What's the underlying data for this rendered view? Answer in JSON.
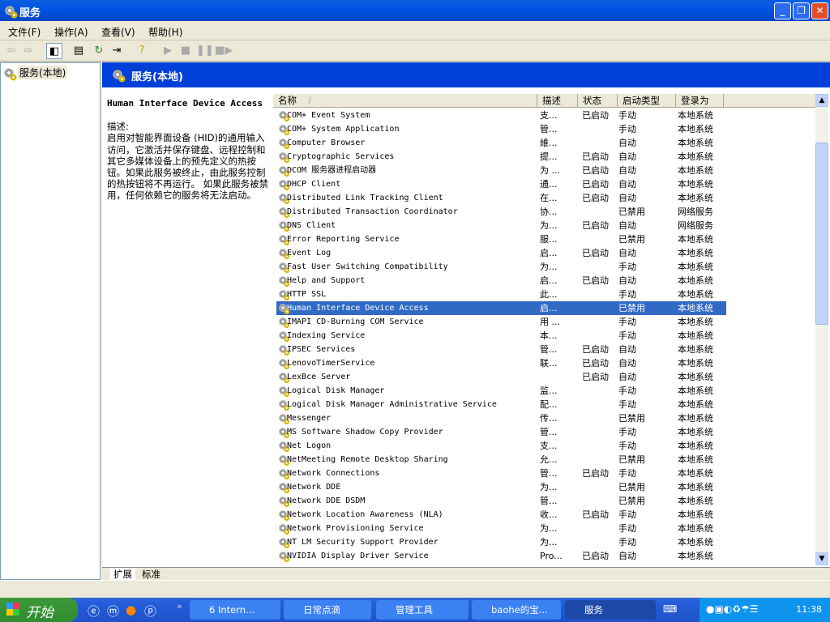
{
  "window": {
    "title": "服务",
    "minimize": "_",
    "restore": "❐",
    "close": "✕"
  },
  "menu": [
    "文件(F)",
    "操作(A)",
    "查看(V)",
    "帮助(H)"
  ],
  "tree": {
    "root": "服务(本地)"
  },
  "pane": {
    "header": "服务(本地)"
  },
  "description": {
    "service_name": "Human Interface Device Access",
    "label": "描述:",
    "text": "启用对智能界面设备 (HID)的通用输入访问，它激活并保存键盘、远程控制和其它多媒体设备上的预先定义的热按钮。如果此服务被终止，由此服务控制的热按钮将不再运行。 如果此服务被禁用，任何依赖它的服务将无法启动。"
  },
  "columns": [
    "名称",
    "描述",
    "状态",
    "启动类型",
    "登录为"
  ],
  "sort_indicator": "/",
  "rows": [
    [
      "COM+ Event System",
      "支...",
      "已启动",
      "手动",
      "本地系统"
    ],
    [
      "COM+ System Application",
      "管...",
      "",
      "手动",
      "本地系统"
    ],
    [
      "Computer Browser",
      "維...",
      "",
      "自动",
      "本地系统"
    ],
    [
      "Cryptographic Services",
      "提...",
      "已启动",
      "自动",
      "本地系统"
    ],
    [
      "DCOM 服务器进程启动器",
      "为 ...",
      "已启动",
      "自动",
      "本地系统"
    ],
    [
      "DHCP Client",
      "通...",
      "已启动",
      "自动",
      "本地系统"
    ],
    [
      "Distributed Link Tracking Client",
      "在...",
      "已启动",
      "自动",
      "本地系统"
    ],
    [
      "Distributed Transaction Coordinator",
      "协...",
      "",
      "已禁用",
      "网络服务"
    ],
    [
      "DNS Client",
      "为...",
      "已启动",
      "自动",
      "网络服务"
    ],
    [
      "Error Reporting Service",
      "服...",
      "",
      "已禁用",
      "本地系统"
    ],
    [
      "Event Log",
      "启...",
      "已启动",
      "自动",
      "本地系统"
    ],
    [
      "Fast User Switching Compatibility",
      "为...",
      "",
      "手动",
      "本地系统"
    ],
    [
      "Help and Support",
      "启...",
      "已启动",
      "自动",
      "本地系统"
    ],
    [
      "HTTP SSL",
      "此...",
      "",
      "手动",
      "本地系统"
    ],
    [
      "Human Interface Device Access",
      "启...",
      "",
      "已禁用",
      "本地系统"
    ],
    [
      "IMAPI CD-Burning COM Service",
      "用 ...",
      "",
      "手动",
      "本地系统"
    ],
    [
      "Indexing Service",
      "本...",
      "",
      "手动",
      "本地系统"
    ],
    [
      "IPSEC Services",
      "管...",
      "已启动",
      "自动",
      "本地系统"
    ],
    [
      "LenovoTimerService",
      "联...",
      "已启动",
      "自动",
      "本地系统"
    ],
    [
      "LexBce Server",
      "",
      "已启动",
      "自动",
      "本地系统"
    ],
    [
      "Logical Disk Manager",
      "监...",
      "",
      "手动",
      "本地系统"
    ],
    [
      "Logical Disk Manager Administrative Service",
      "配...",
      "",
      "手动",
      "本地系统"
    ],
    [
      "Messenger",
      "传...",
      "",
      "已禁用",
      "本地系统"
    ],
    [
      "MS Software Shadow Copy Provider",
      "管...",
      "",
      "手动",
      "本地系统"
    ],
    [
      "Net Logon",
      "支...",
      "",
      "手动",
      "本地系统"
    ],
    [
      "NetMeeting Remote Desktop Sharing",
      "允...",
      "",
      "已禁用",
      "本地系统"
    ],
    [
      "Network Connections",
      "管...",
      "已启动",
      "手动",
      "本地系统"
    ],
    [
      "Network DDE",
      "为...",
      "",
      "已禁用",
      "本地系统"
    ],
    [
      "Network DDE DSDM",
      "管...",
      "",
      "已禁用",
      "本地系统"
    ],
    [
      "Network Location Awareness (NLA)",
      "收...",
      "已启动",
      "手动",
      "本地系统"
    ],
    [
      "Network Provisioning Service",
      "为...",
      "",
      "手动",
      "本地系统"
    ],
    [
      "NT LM Security Support Provider",
      "为...",
      "",
      "手动",
      "本地系统"
    ],
    [
      "NVIDIA Display Driver Service",
      "Pro...",
      "已启动",
      "自动",
      "本地系统"
    ]
  ],
  "selected_row": 14,
  "tabs": [
    "扩展",
    "标准"
  ],
  "taskbar": {
    "start": "开始",
    "more": "»",
    "tasks": [
      "6 Intern...",
      "日常点滴",
      "管理工具",
      "baohe的宝...",
      "服务"
    ],
    "clock": "11:38"
  },
  "colors": {
    "title": "#0054e3",
    "selection": "#316ac5",
    "pane_header": "#0040d8"
  }
}
